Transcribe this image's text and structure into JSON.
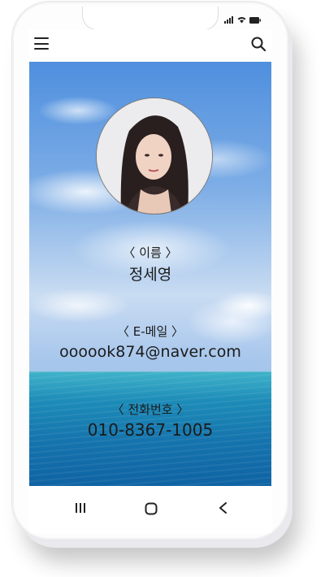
{
  "profile": {
    "name_caption": "〈 이름 〉",
    "name": "정세영",
    "email_caption": "〈 E-메일 〉",
    "email": "oooook874@naver.com",
    "phone_caption": "〈 전화번호 〉",
    "phone": "010-8367-1005"
  },
  "icons": {
    "menu": "hamburger-menu-icon",
    "search": "search-icon",
    "nav_recent": "recent-apps-icon",
    "nav_home": "home-icon",
    "nav_back": "back-icon"
  },
  "colors": {
    "text": "#1b1b1b",
    "sky": "#7eaee6",
    "sea": "#1574ad"
  }
}
